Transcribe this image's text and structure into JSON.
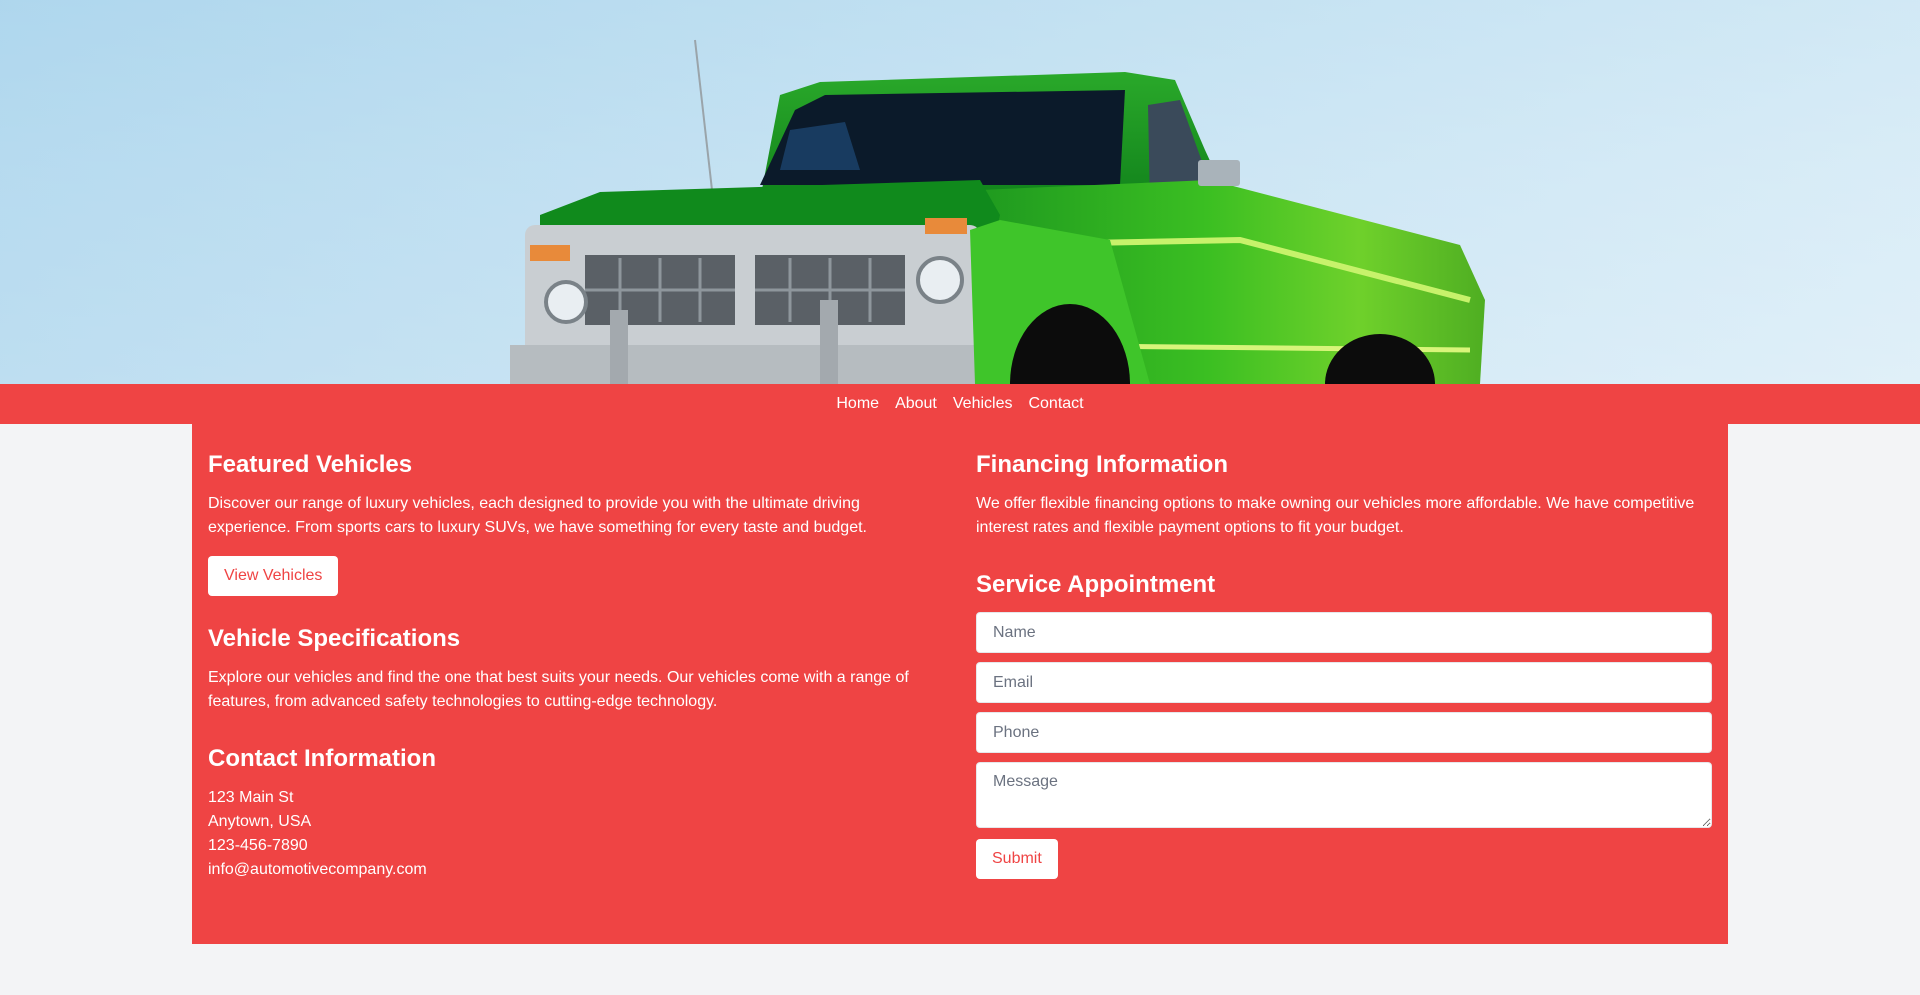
{
  "hero": {
    "image_alt": "green-pickup-truck-photo",
    "sky_color": "#c5e3f3",
    "truck_color": "#3fbf1f"
  },
  "nav": {
    "items": [
      {
        "label": "Home"
      },
      {
        "label": "About"
      },
      {
        "label": "Vehicles"
      },
      {
        "label": "Contact"
      }
    ]
  },
  "featured": {
    "title": "Featured Vehicles",
    "text": "Discover our range of luxury vehicles, each designed to provide you with the ultimate driving experience. From sports cars to luxury SUVs, we have something for every taste and budget.",
    "button_label": "View Vehicles"
  },
  "specs": {
    "title": "Vehicle Specifications",
    "text": "Explore our vehicles and find the one that best suits your needs. Our vehicles come with a range of features, from advanced safety technologies to cutting-edge technology."
  },
  "contact": {
    "title": "Contact Information",
    "address_line1": "123 Main St",
    "address_line2": "Anytown, USA",
    "phone": "123-456-7890",
    "email": "info@automotivecompany.com"
  },
  "financing": {
    "title": "Financing Information",
    "text": "We offer flexible financing options to make owning our vehicles more affordable. We have competitive interest rates and flexible payment options to fit your budget."
  },
  "service": {
    "title": "Service Appointment",
    "name_placeholder": "Name",
    "email_placeholder": "Email",
    "phone_placeholder": "Phone",
    "message_placeholder": "Message",
    "submit_label": "Submit"
  },
  "colors": {
    "accent": "#ef4444",
    "page_bg": "#f3f4f6",
    "text": "#ffffff"
  }
}
